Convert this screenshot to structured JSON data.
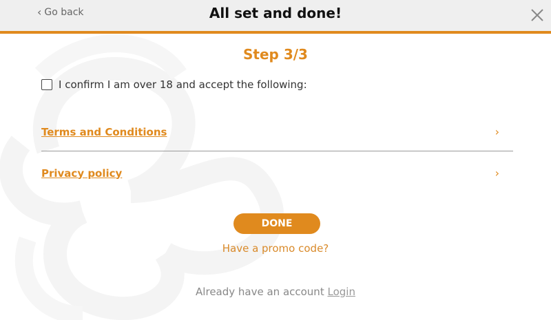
{
  "header": {
    "back_label": "Go back",
    "title": "All set and done!"
  },
  "content": {
    "step_label": "Step 3/3",
    "confirm_text": "I confirm I am over 18 and accept the following:",
    "links": [
      {
        "label": "Terms and Conditions"
      },
      {
        "label": "Privacy policy"
      }
    ],
    "done_label": "DONE",
    "promo_label": "Have a promo code?",
    "account_text": "Already have an account",
    "login_label": "Login"
  },
  "colors": {
    "accent": "#e08a1e",
    "header_bg": "#efefef"
  },
  "icons": {
    "back": "chevron-left-icon",
    "close": "close-icon",
    "arrow": "chevron-right-icon"
  }
}
